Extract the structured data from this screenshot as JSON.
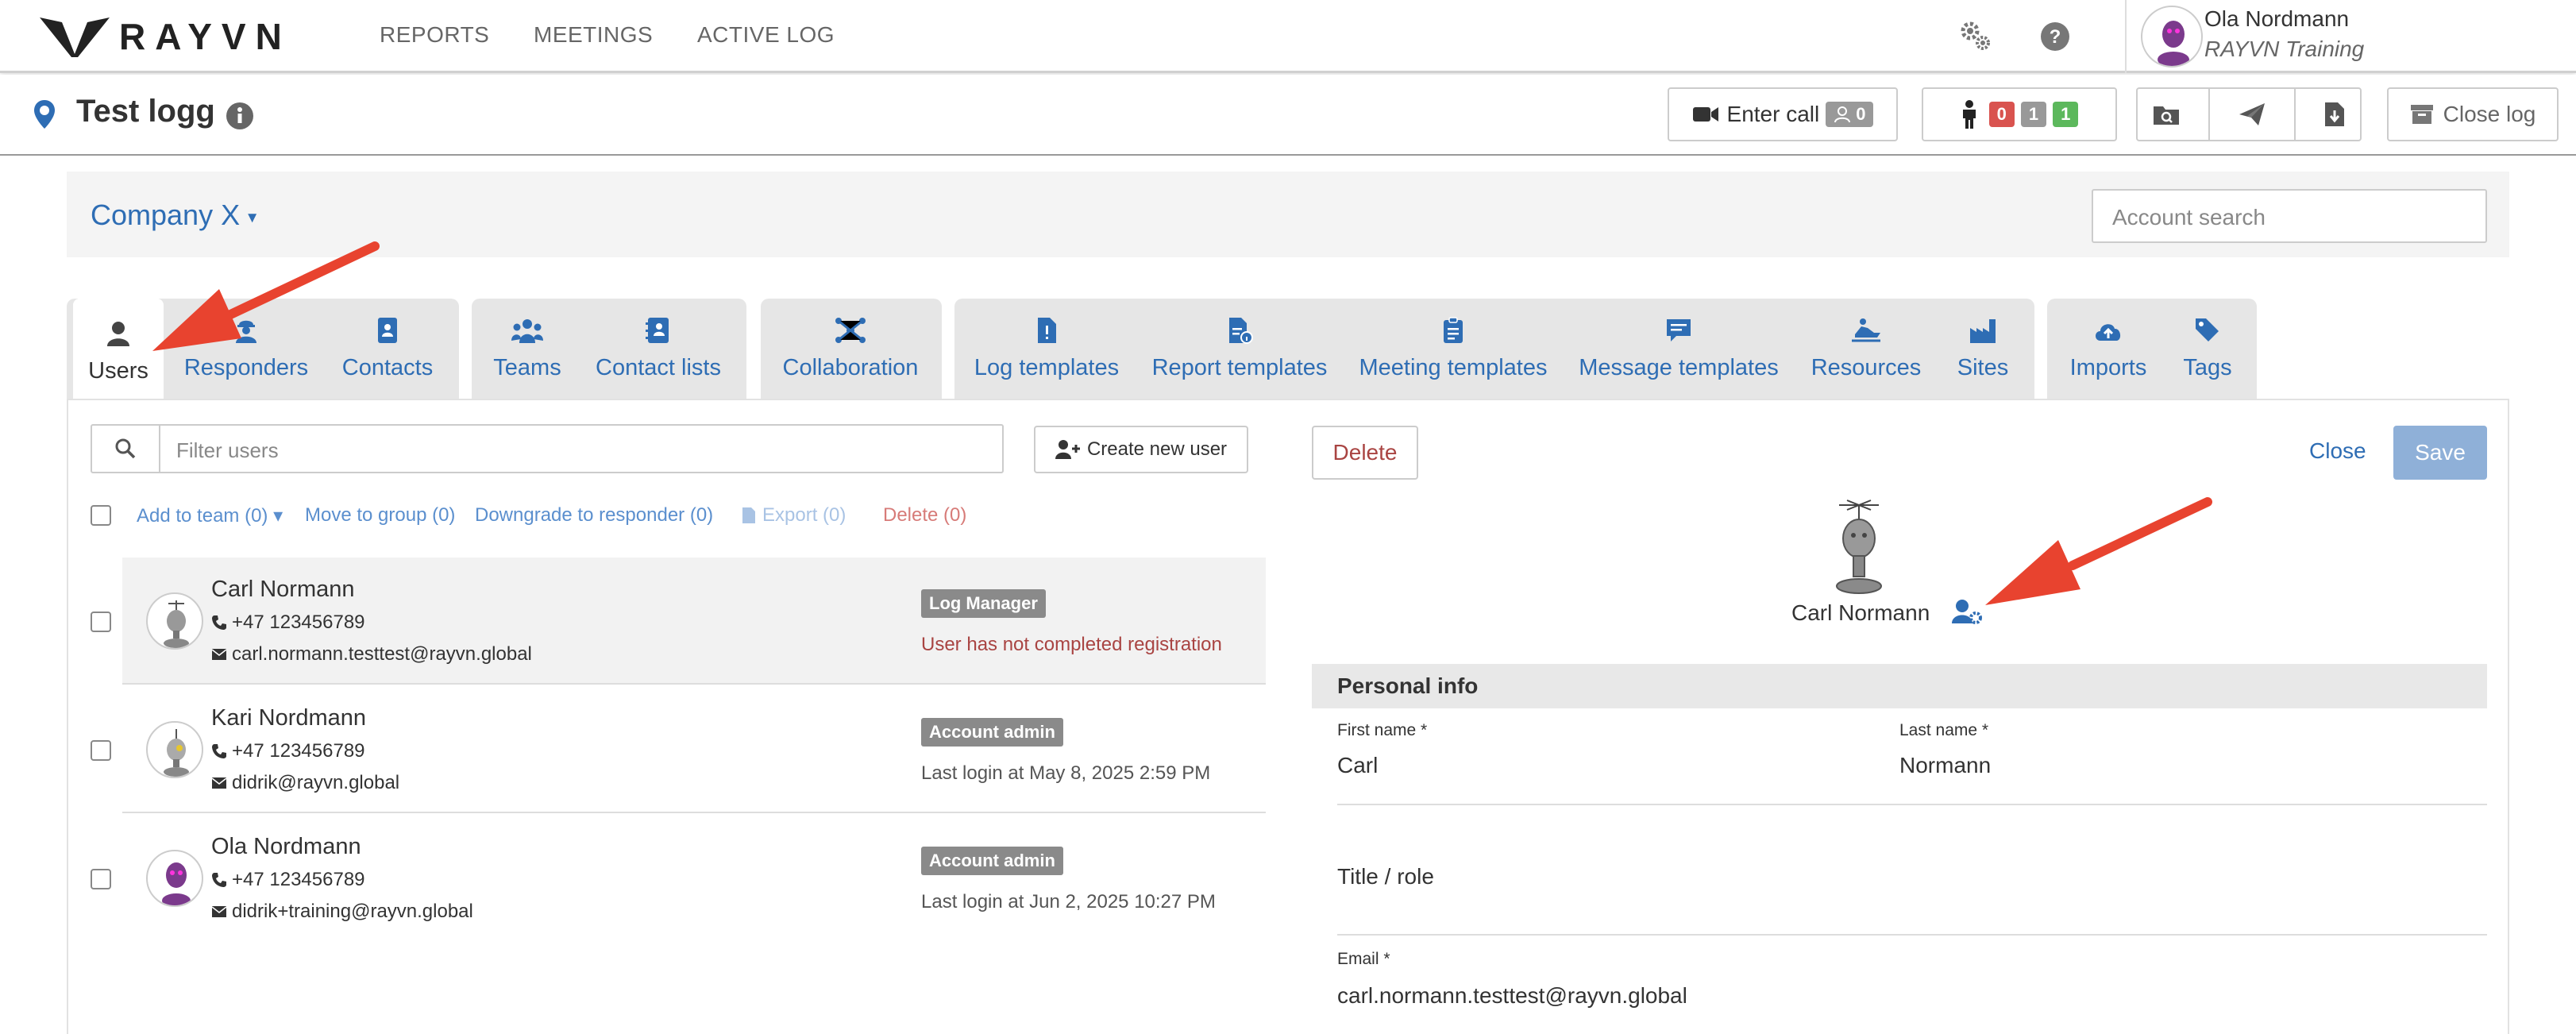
{
  "brand": {
    "logo_text": "RAYVN"
  },
  "nav": {
    "items": [
      "REPORTS",
      "MEETINGS",
      "ACTIVE LOG"
    ]
  },
  "user": {
    "name": "Ola Nordmann",
    "org": "RAYVN Training"
  },
  "log": {
    "title": "Test logg"
  },
  "toolbar": {
    "enter_call": "Enter call",
    "call_count": "0",
    "counts": [
      "0",
      "1",
      "1"
    ],
    "close_log": "Close log"
  },
  "company": {
    "name": "Company X",
    "search_placeholder": "Account search"
  },
  "tabs": [
    {
      "label": "Users",
      "icon": "user-icon"
    },
    {
      "label": "Responders",
      "icon": "responder-icon"
    },
    {
      "label": "Contacts",
      "icon": "contact-card-icon"
    },
    {
      "label": "Teams",
      "icon": "team-icon"
    },
    {
      "label": "Contact lists",
      "icon": "contact-list-icon"
    },
    {
      "label": "Collaboration",
      "icon": "network-icon"
    },
    {
      "label": "Log templates",
      "icon": "log-template-icon"
    },
    {
      "label": "Report templates",
      "icon": "report-template-icon"
    },
    {
      "label": "Meeting templates",
      "icon": "clipboard-icon"
    },
    {
      "label": "Message templates",
      "icon": "message-icon"
    },
    {
      "label": "Resources",
      "icon": "snowmobile-icon"
    },
    {
      "label": "Sites",
      "icon": "industry-icon"
    },
    {
      "label": "Imports",
      "icon": "cloud-upload-icon"
    },
    {
      "label": "Tags",
      "icon": "tags-icon"
    }
  ],
  "users_panel": {
    "filter_placeholder": "Filter users",
    "create_button": "Create new user",
    "bulk_actions": [
      "Add to team (0)",
      "Move to group (0)",
      "Downgrade to responder (0)",
      "Export (0)",
      "Delete (0)"
    ],
    "rows": [
      {
        "name": "Carl Normann",
        "phone": "+47 123456789",
        "email": "carl.normann.testtest@rayvn.global",
        "role": "Log Manager",
        "status": "User has not completed registration",
        "status_color": "#a94442"
      },
      {
        "name": "Kari Nordmann",
        "phone": "+47 123456789",
        "email": "didrik@rayvn.global",
        "role": "Account admin",
        "status": "Last login at May 8, 2025 2:59 PM",
        "status_color": "#555555"
      },
      {
        "name": "Ola Nordmann",
        "phone": "+47 123456789",
        "email": "didrik+training@rayvn.global",
        "role": "Account admin",
        "status": "Last login at Jun 2, 2025 10:27 PM",
        "status_color": "#555555"
      }
    ]
  },
  "detail": {
    "delete": "Delete",
    "close": "Close",
    "save": "Save",
    "name": "Carl Normann",
    "section": "Personal info",
    "first_name_label": "First name *",
    "first_name": "Carl",
    "last_name_label": "Last name *",
    "last_name": "Normann",
    "title_label": "Title / role",
    "email_label": "Email *",
    "email": "carl.normann.testtest@rayvn.global"
  },
  "colors": {
    "link": "#2e6db4",
    "danger": "#a94442",
    "arrow": "#e8432f",
    "badge_red": "#d9534f",
    "badge_grey": "#999999",
    "badge_green": "#5cb85c",
    "save_bg": "#8fb0d8"
  }
}
